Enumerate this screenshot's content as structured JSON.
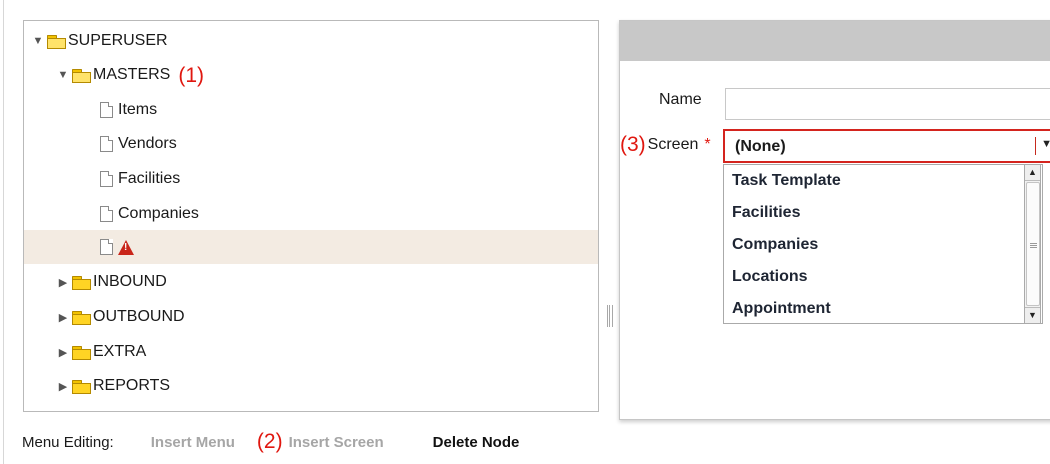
{
  "tree": {
    "root": {
      "label": "SUPERUSER",
      "expanded": true
    },
    "masters": {
      "label": "MASTERS",
      "annotation": "(1)",
      "expanded": true
    },
    "items": [
      {
        "label": "Items"
      },
      {
        "label": "Vendors"
      },
      {
        "label": "Facilities"
      },
      {
        "label": "Companies"
      }
    ],
    "new_node": {
      "label": "",
      "status_icon": "warning-icon"
    },
    "folders": [
      {
        "label": "INBOUND"
      },
      {
        "label": "OUTBOUND"
      },
      {
        "label": "EXTRA"
      },
      {
        "label": "REPORTS"
      }
    ]
  },
  "menu_editing": {
    "label": "Menu Editing:",
    "insert_menu": "Insert Menu",
    "annotation": "(2)",
    "insert_screen": "Insert Screen",
    "delete_node": "Delete Node"
  },
  "form": {
    "name_label": "Name",
    "name_value": "",
    "screen_annotation": "(3)",
    "screen_label": "Screen",
    "required_marker": "*",
    "screen_selected": "(None)",
    "options": [
      "Task Template",
      "Facilities",
      "Companies",
      "Locations",
      "Appointment"
    ]
  },
  "colors": {
    "annotation_red": "#e0170f",
    "selected_row": "#f3ebe2",
    "folder_yellow": "#ffd424",
    "dialog_header": "#c8c8c8"
  }
}
